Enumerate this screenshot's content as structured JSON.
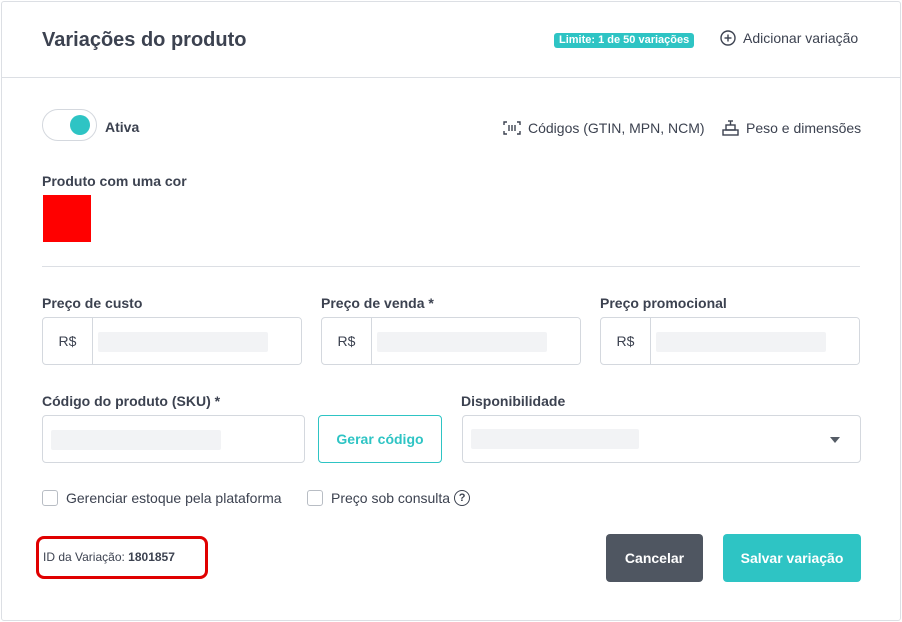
{
  "header": {
    "title": "Variações do produto",
    "limit_badge": "Limite:  1 de 50 variações",
    "add_variation": "Adicionar variação"
  },
  "status": {
    "toggle_on": true,
    "label": "Ativa"
  },
  "links": {
    "codes": "Códigos (GTIN, MPN, NCM)",
    "weight": "Peso e dimensões"
  },
  "color": {
    "label": "Produto com uma cor",
    "value": "#ff0000"
  },
  "prices": {
    "cost": {
      "label": "Preço de custo",
      "prefix": "R$"
    },
    "sale": {
      "label": "Preço de venda *",
      "prefix": "R$"
    },
    "promo": {
      "label": "Preço promocional",
      "prefix": "R$"
    }
  },
  "sku": {
    "label": "Código do produto (SKU) *",
    "generate_button": "Gerar código"
  },
  "availability": {
    "label": "Disponibilidade"
  },
  "checkboxes": {
    "manage_stock": "Gerenciar estoque pela plataforma",
    "price_on_request": "Preço sob consulta",
    "help_glyph": "?"
  },
  "variation_id": {
    "label": "ID da Variação:",
    "value": "1801857"
  },
  "actions": {
    "cancel": "Cancelar",
    "save": "Salvar variação"
  },
  "colors": {
    "accent": "#2ec4c4",
    "cancel_bg": "#4f5661",
    "highlight_border": "#e00000"
  }
}
